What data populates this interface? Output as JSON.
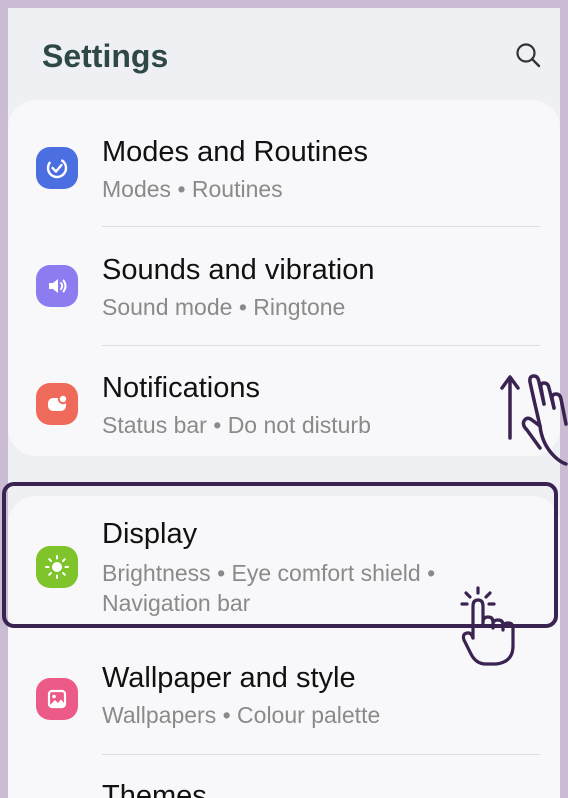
{
  "header": {
    "title": "Settings",
    "search_icon": "search-icon"
  },
  "settings_items": [
    {
      "id": "modes-routines",
      "label": "Modes and Routines",
      "sub": [
        "Modes",
        "Routines"
      ],
      "icon": "check-circle-icon",
      "color": "#4b6fe0"
    },
    {
      "id": "sounds-vibration",
      "label": "Sounds and vibration",
      "sub": [
        "Sound mode",
        "Ringtone"
      ],
      "icon": "speaker-icon",
      "color": "#8b7cf0"
    },
    {
      "id": "notifications",
      "label": "Notifications",
      "sub": [
        "Status bar",
        "Do not disturb"
      ],
      "icon": "notification-icon",
      "color": "#ef6a5a"
    },
    {
      "id": "display",
      "label": "Display",
      "sub": [
        "Brightness",
        "Eye comfort shield",
        "Navigation bar"
      ],
      "icon": "sun-icon",
      "color": "#7fc42b"
    },
    {
      "id": "wallpaper-style",
      "label": "Wallpaper and style",
      "sub": [
        "Wallpapers",
        "Colour palette"
      ],
      "icon": "image-icon",
      "color": "#ec5a88"
    },
    {
      "id": "themes",
      "label": "Themes",
      "sub": [],
      "icon": "",
      "color": ""
    }
  ],
  "separator": "•",
  "colors": {
    "highlight_border": "#3a2350",
    "title": "#2e4848",
    "background": "#eef0f4"
  }
}
